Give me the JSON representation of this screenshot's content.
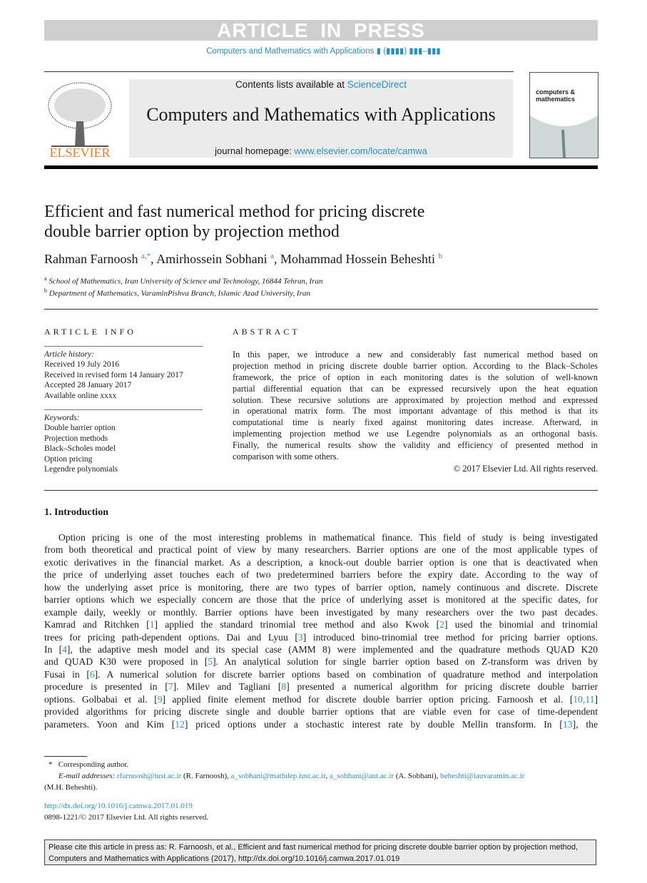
{
  "banner_text": "ARTICLE IN PRESS",
  "running_head": "Computers and Mathematics with Applications ▮ (▮▮▮▮) ▮▮▮–▮▮▮",
  "masthead": {
    "contents_prefix": "Contents lists available at ",
    "contents_link": "ScienceDirect",
    "journal_title": "Computers and Mathematics with Applications",
    "homepage_prefix": "journal homepage: ",
    "homepage_link": "www.elsevier.com/locate/camwa",
    "publisher_logo": "ELSEVIER",
    "cover_text": "computers & mathematics"
  },
  "article": {
    "title_line1": "Efficient and fast numerical method for pricing discrete",
    "title_line2": "double barrier option by projection method",
    "authors": [
      {
        "name": "Rahman Farnoosh",
        "sup": "a,*"
      },
      {
        "name": "Amirhossein Sobhani",
        "sup": "a"
      },
      {
        "name": "Mohammad Hossein Beheshti",
        "sup": "b"
      }
    ],
    "affiliations": [
      {
        "sup": "a",
        "text": "School of Mathematics, Iran University of Science and Technology, 16844 Tehran, Iran"
      },
      {
        "sup": "b",
        "text": "Department of Mathematics, VaraminPishva Branch, Islamic Azad University, Iran"
      }
    ]
  },
  "article_info": {
    "heading": "ARTICLE INFO",
    "history_label": "Article history:",
    "history": [
      "Received 19 July 2016",
      "Received in revised form 14 January 2017",
      "Accepted 28 January 2017",
      "Available online xxxx"
    ],
    "keywords_label": "Keywords:",
    "keywords": [
      "Double barrier option",
      "Projection methods",
      "Black–Scholes model",
      "Option pricing",
      "Legendre polynomials"
    ]
  },
  "abstract": {
    "heading": "ABSTRACT",
    "lines": [
      "In this paper, we introduce a new and considerably fast numerical method based on",
      "projection method in pricing discrete double barrier option. According to the Black–Scholes",
      "framework, the price of option in each monitoring dates is the solution of well-known",
      "partial differential equation that can be expressed recursively upon the heat equation",
      "solution. These recursive solutions are approximated by projection method and expressed",
      "in operational matrix form. The most important advantage of this method is that its",
      "computational time is nearly fixed against monitoring dates increase. Afterward, in",
      "implementing projection method we use Legendre polynomials as an orthogonal basis.",
      "Finally, the numerical results show the validity and efficiency of presented method in",
      "comparison with some others."
    ],
    "copyright": "© 2017 Elsevier Ltd. All rights reserved."
  },
  "introduction": {
    "heading": "1.  Introduction",
    "lines": [
      "Option pricing is one of the most interesting problems in mathematical finance. This field of study is being investigated",
      "from both theoretical and practical point of view by many researchers. Barrier options are one of the most applicable types of",
      "exotic derivatives in the financial market. As a description, a knock-out double barrier option is one that is deactivated when",
      "the price of underlying asset touches each of two predetermined barriers before the expiry date. According to the way of",
      "how the underlying asset price is monitoring, there are two types of barrier option, namely continuous and discrete. Discrete",
      "barrier options which we especially concern are those that the price of underlying asset is monitored at the specific dates, for",
      "example daily, weekly or monthly.  Barrier options have been investigated by many researchers over the two past decades.",
      "Kamrad and Ritchken [1] applied the standard trinomial tree method and also Kwok [2] used the binomial and trinomial",
      "trees for pricing path-dependent options. Dai and Lyuu [3] introduced bino-trinomial tree method for pricing barrier options.",
      "In [4], the adaptive mesh model and its special case (AMM 8) were implemented and the quadrature methods QUAD K20",
      "and QUAD K30 were proposed in [5]. An analytical solution for single barrier option based on Z-transform was driven by",
      "Fusai in [6]. A numerical solution for discrete barrier options based on combination of quadrature method and interpolation",
      "procedure is presented in [7]. Milev and Tagliani [8] presented a numerical algorithm for pricing discrete double barrier",
      "options. Golbabai et al. [9] applied finite element method for discrete double barrier option pricing. Farnoosh et al. [10,11]",
      "provided algorithms for pricing discrete single and double barrier options that are viable even for case of time-dependent",
      "parameters. Yoon and Kim [12] priced options under a stochastic interest rate by double Mellin transform. In [13], the"
    ]
  },
  "footnote": {
    "star": "*",
    "corresponding": "Corresponding author.",
    "email_label": "E-mail addresses:",
    "emails": [
      {
        "addr": "rfarnoosh@iust.ac.ir",
        "after": " (R. Farnoosh), "
      },
      {
        "addr": "a_sobhani@mathdep.iust.ac.ir",
        "after": ", "
      },
      {
        "addr": "a_sobhani@aut.ac.ir",
        "after": " (A. Sobhani), "
      },
      {
        "addr": "beheshti@iauvaramin.ac.ir",
        "after": ""
      }
    ],
    "last_name": "(M.H. Beheshti).",
    "doi": "http://dx.doi.org/10.1016/j.camwa.2017.01.019",
    "issn": "0898-1221/© 2017 Elsevier Ltd. All rights reserved."
  },
  "cite_box": {
    "line1": "Please cite this article in press as: R. Farnoosh, et al., Efficient and fast numerical method for pricing discrete double barrier option by projection method,",
    "line2": "Computers and Mathematics with Applications (2017), http://dx.doi.org/10.1016/j.camwa.2017.01.019"
  },
  "colors": {
    "link": "#2a8fbd",
    "elsevier_orange": "#f07a22",
    "banner_gray": "#cfcfcf",
    "masthead_gray": "#ebebeb"
  }
}
